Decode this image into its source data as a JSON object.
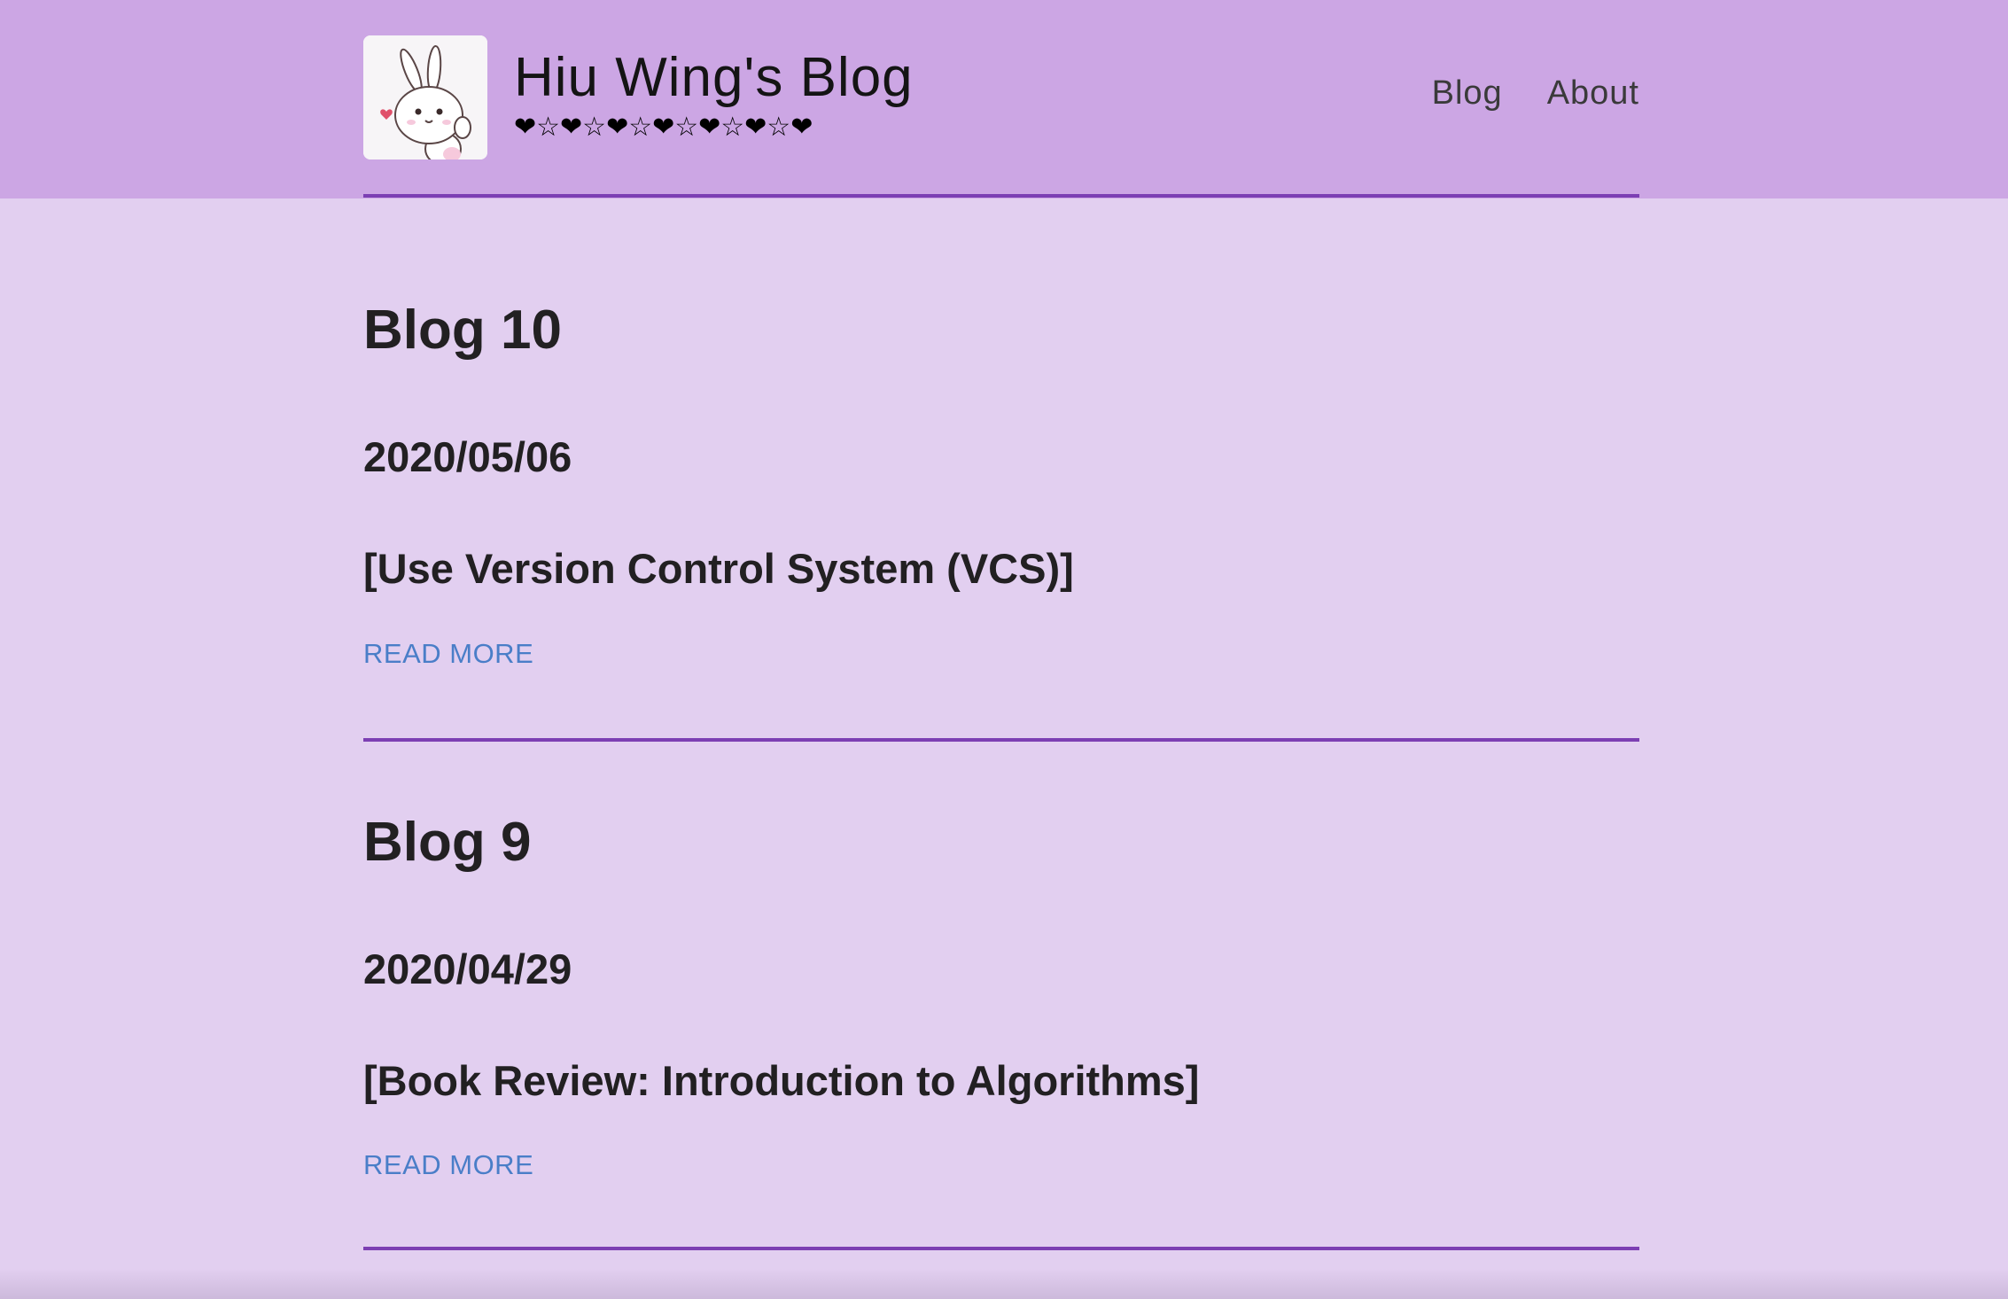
{
  "header": {
    "title": "Hiu Wing's Blog",
    "tagline": "❤☆❤☆❤☆❤☆❤☆❤☆❤",
    "logo_icon": "bunny-icon",
    "nav": [
      {
        "label": "Blog"
      },
      {
        "label": "About"
      }
    ]
  },
  "posts": [
    {
      "title": "Blog 10",
      "date": "2020/05/06",
      "summary": "[Use Version Control System (VCS)]",
      "read_more": "READ MORE"
    },
    {
      "title": "Blog 9",
      "date": "2020/04/29",
      "summary": "[Book Review: Introduction to Algorithms]",
      "read_more": "READ MORE"
    }
  ],
  "colors": {
    "header_bg": "#cca6e4",
    "page_bg": "#e2cff0",
    "rule": "#7c3fb3",
    "link": "#4a7ec8",
    "text": "#222022"
  }
}
